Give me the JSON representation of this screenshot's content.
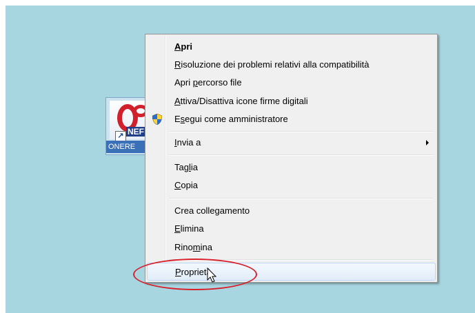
{
  "desktop": {
    "background_color": "#a8d6e0",
    "shortcut": {
      "label": "ONERE",
      "brand_text": "NEF",
      "arrow_glyph": "↗"
    }
  },
  "context_menu": {
    "items": [
      {
        "label_pre": "",
        "label_ul": "A",
        "label_post": "pri",
        "bold": true
      },
      {
        "label_pre": "",
        "label_ul": "R",
        "label_post": "isoluzione dei problemi relativi alla compatibilità"
      },
      {
        "label_pre": "Apri ",
        "label_ul": "p",
        "label_post": "ercorso file"
      },
      {
        "label_pre": "",
        "label_ul": "A",
        "label_post": "ttiva/Disattiva icone firme digitali"
      },
      {
        "label_pre": "E",
        "label_ul": "s",
        "label_post": "egui come amministratore",
        "icon": "uac-shield-icon"
      },
      {
        "label_pre": "",
        "label_ul": "I",
        "label_post": "nvia a",
        "submenu": true
      },
      {
        "label_pre": "Tag",
        "label_ul": "l",
        "label_post": "ia"
      },
      {
        "label_pre": "",
        "label_ul": "C",
        "label_post": "opia"
      },
      {
        "label_pre": "Crea colle",
        "label_ul": "g",
        "label_post": "amento"
      },
      {
        "label_pre": "",
        "label_ul": "E",
        "label_post": "limina"
      },
      {
        "label_pre": "Rino",
        "label_ul": "m",
        "label_post": "ina"
      },
      {
        "label_pre": "",
        "label_ul": "P",
        "label_post": "roprietà",
        "hover": true
      }
    ]
  },
  "annotation": {
    "highlight_color": "#d8202a"
  }
}
